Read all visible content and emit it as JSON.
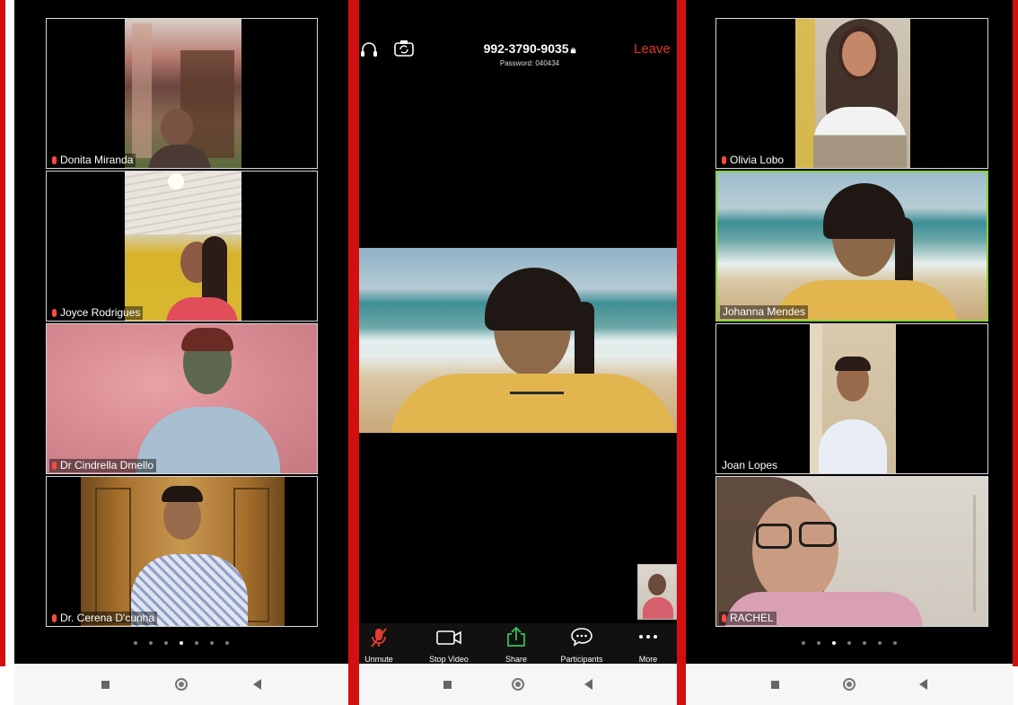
{
  "left_panel": {
    "participants": [
      {
        "name": "Donita Miranda"
      },
      {
        "name": "Joyce Rodrigues"
      },
      {
        "name": "Dr Cindrella Dmello"
      },
      {
        "name": "Dr. Cerena D'cunha"
      }
    ],
    "page_dots": 7,
    "active_dot": 3
  },
  "center_panel": {
    "meeting_id": "992-3790-9035",
    "password": "Password: 040434",
    "leave_label": "Leave",
    "toolbar": {
      "unmute": "Unmute",
      "stop_video": "Stop Video",
      "share": "Share",
      "participants": "Participants",
      "more": "More"
    }
  },
  "right_panel": {
    "participants": [
      {
        "name": "Olivia Lobo"
      },
      {
        "name": "Johanna Mendes"
      },
      {
        "name": "Joan Lopes"
      },
      {
        "name": "RACHEL"
      }
    ],
    "page_dots": 7,
    "active_dot": 2
  },
  "colors": {
    "frame_red": "#d40f10",
    "leave_red": "#e0342a",
    "active_speaker": "#8bd13b",
    "share_green": "#3ec25b"
  }
}
